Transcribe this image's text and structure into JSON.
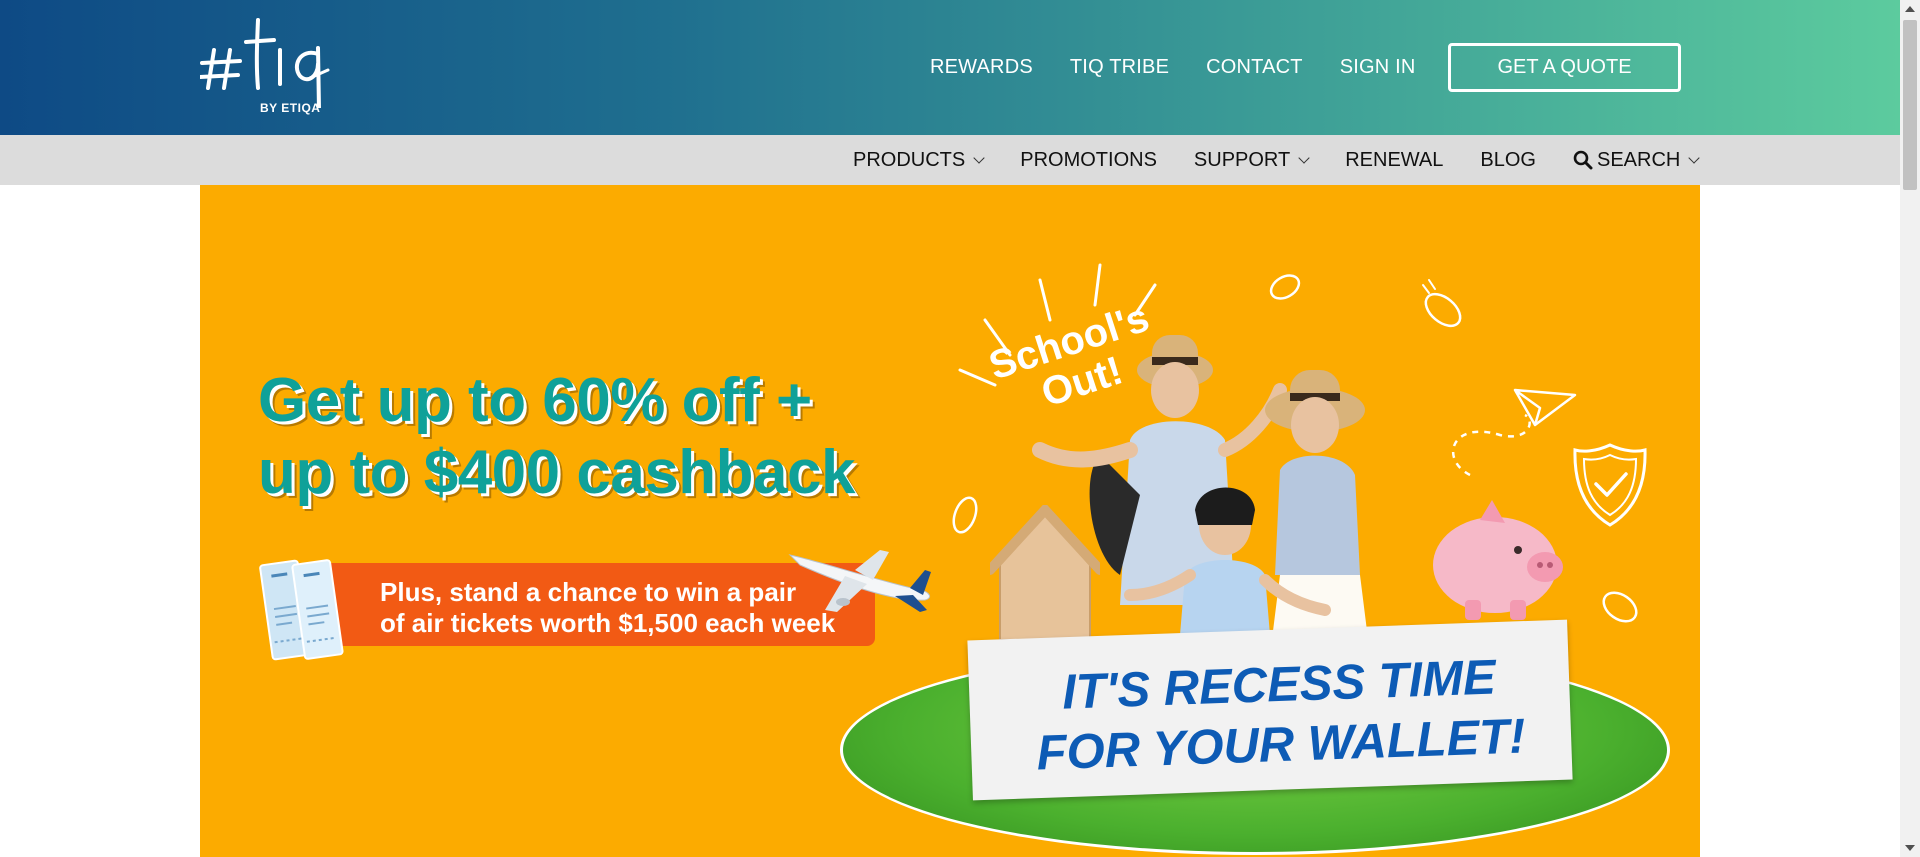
{
  "brand": {
    "logo_text": "#tiq",
    "logo_sub": "BY ETIQA"
  },
  "topnav": {
    "items": [
      "REWARDS",
      "TIQ TRIBE",
      "CONTACT",
      "SIGN IN"
    ],
    "cta": "GET A QUOTE"
  },
  "subnav": {
    "items": [
      {
        "label": "PRODUCTS",
        "dropdown": true
      },
      {
        "label": "PROMOTIONS",
        "dropdown": false
      },
      {
        "label": "SUPPORT",
        "dropdown": true
      },
      {
        "label": "RENEWAL",
        "dropdown": false
      },
      {
        "label": "BLOG",
        "dropdown": false
      },
      {
        "label": "SEARCH",
        "dropdown": true,
        "icon": "search-icon"
      }
    ]
  },
  "hero": {
    "headline_line1": "Get up to 60% off +",
    "headline_line2": "up to $400 cashback",
    "promo_line1": "Plus, stand a chance to win a pair",
    "promo_line2": "of air tickets worth $1,500 each week",
    "badge_line1": "School's",
    "badge_line2": "Out!",
    "sign_line1": "IT'S RECESS TIME",
    "sign_line2": "FOR YOUR WALLET!"
  },
  "colors": {
    "header_start": "#0e4a85",
    "header_end": "#5ccb9e",
    "subnav_bg": "#dcdcdc",
    "hero_bg": "#fcab00",
    "headline": "#0fa199",
    "promo_pill": "#f25a14",
    "sign_text": "#0d5bb5"
  }
}
